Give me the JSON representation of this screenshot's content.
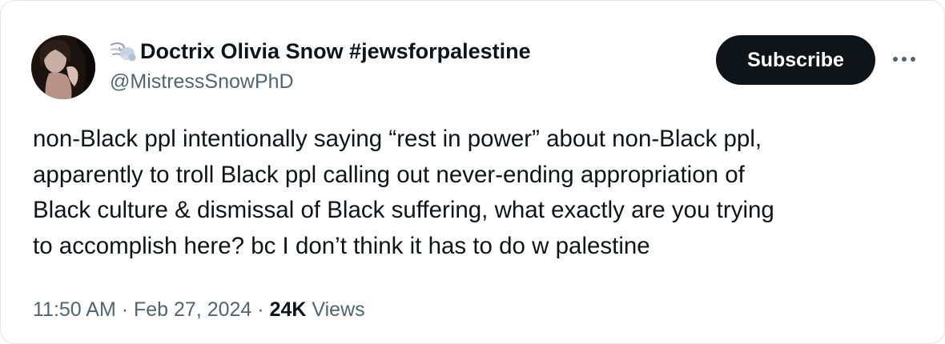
{
  "author": {
    "display_name": "Doctrix Olivia Snow #jewsforpalestine",
    "name_emoji_icon": "wind-face-emoji-icon",
    "handle": "@MistressSnowPhD"
  },
  "actions": {
    "subscribe_label": "Subscribe",
    "more_icon": "more-dots-icon"
  },
  "tweet": {
    "lines": [
      "non-Black ppl intentionally saying “rest in power” about non-Black ppl,",
      "apparently to troll Black ppl calling out never-ending appropriation of",
      "Black culture & dismissal of Black suffering, what exactly are you trying",
      "to accomplish here? bc I don’t think it has to do w palestine"
    ]
  },
  "meta": {
    "time": "11:50 AM",
    "separator": " · ",
    "date": "Feb 27, 2024",
    "views_count": "24K",
    "views_label": "Views"
  },
  "colors": {
    "text_primary": "#0f1419",
    "text_secondary": "#536471",
    "button_bg": "#0f1419",
    "button_text": "#ffffff",
    "border": "#e1e4e8"
  }
}
